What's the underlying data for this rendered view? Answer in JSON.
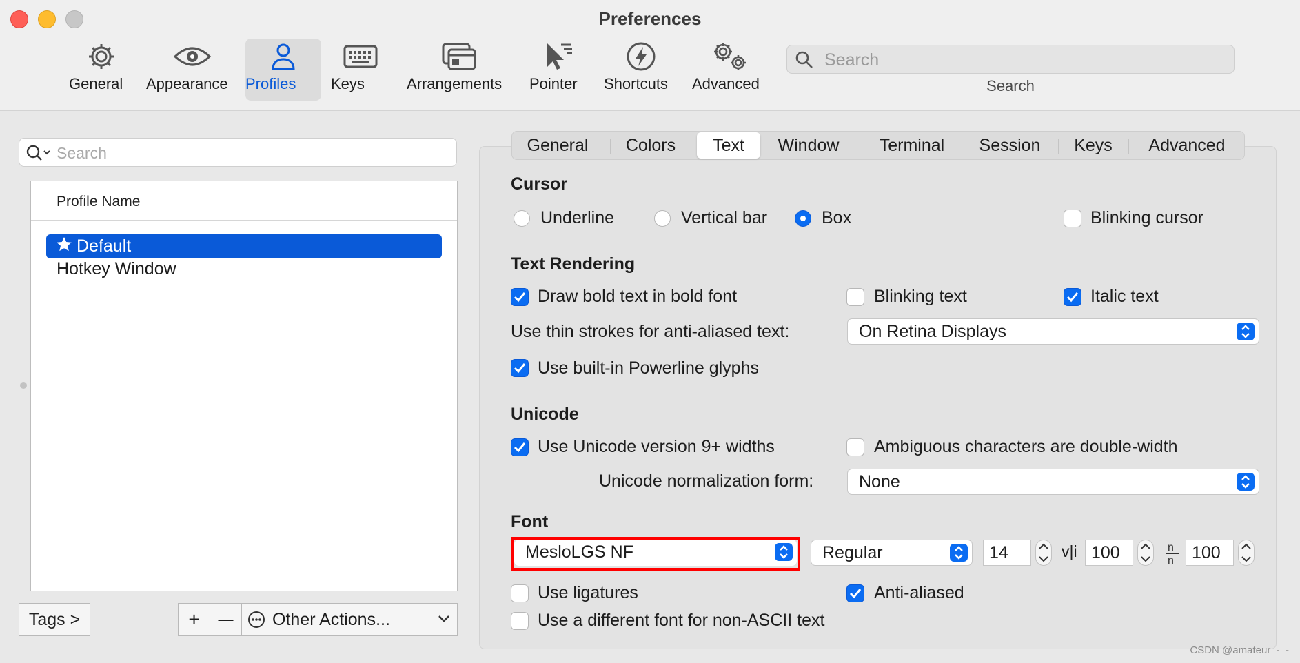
{
  "window": {
    "title": "Preferences"
  },
  "toolbar": {
    "items": [
      {
        "label": "General",
        "icon": "gear-icon"
      },
      {
        "label": "Appearance",
        "icon": "eye-icon"
      },
      {
        "label": "Profiles",
        "icon": "person-icon",
        "active": true
      },
      {
        "label": "Keys",
        "icon": "keyboard-icon"
      },
      {
        "label": "Arrangements",
        "icon": "windows-icon"
      },
      {
        "label": "Pointer",
        "icon": "pointer-icon"
      },
      {
        "label": "Shortcuts",
        "icon": "lightning-icon"
      },
      {
        "label": "Advanced",
        "icon": "gears-icon"
      }
    ],
    "search": {
      "placeholder": "Search",
      "caption": "Search"
    }
  },
  "profiles": {
    "search_placeholder": "Search",
    "column_header": "Profile Name",
    "items": [
      {
        "name": "Default",
        "selected": true,
        "starred": true
      },
      {
        "name": "Hotkey Window",
        "selected": false
      }
    ],
    "tags_button": "Tags >",
    "add_button": "+",
    "remove_button": "—",
    "other_actions": "Other Actions..."
  },
  "tabs": [
    {
      "label": "General"
    },
    {
      "label": "Colors"
    },
    {
      "label": "Text",
      "active": true
    },
    {
      "label": "Window"
    },
    {
      "label": "Terminal"
    },
    {
      "label": "Session"
    },
    {
      "label": "Keys"
    },
    {
      "label": "Advanced"
    }
  ],
  "cursor": {
    "title": "Cursor",
    "underline": "Underline",
    "vertical_bar": "Vertical bar",
    "box": "Box",
    "selected": "Box",
    "blinking_cursor": "Blinking cursor",
    "blinking_cursor_checked": false
  },
  "text_rendering": {
    "title": "Text Rendering",
    "bold_label": "Draw bold text in bold font",
    "bold_checked": true,
    "blinking_label": "Blinking text",
    "blinking_checked": false,
    "italic_label": "Italic text",
    "italic_checked": true,
    "thin_strokes_label": "Use thin strokes for anti-aliased text:",
    "thin_strokes_value": "On Retina Displays",
    "powerline_label": "Use built-in Powerline glyphs",
    "powerline_checked": true
  },
  "unicode": {
    "title": "Unicode",
    "widths_label": "Use Unicode version 9+ widths",
    "widths_checked": true,
    "ambiguous_label": "Ambiguous characters are double-width",
    "ambiguous_checked": false,
    "normalization_label": "Unicode normalization form:",
    "normalization_value": "None"
  },
  "font": {
    "title": "Font",
    "family": "MesloLGS NF",
    "style": "Regular",
    "size": "14",
    "vertical_spacing": "100",
    "horizontal_spacing": "100",
    "ligatures_label": "Use ligatures",
    "ligatures_checked": false,
    "anti_aliased_label": "Anti-aliased",
    "anti_aliased_checked": true,
    "non_ascii_label": "Use a different font for non-ASCII text",
    "non_ascii_checked": false
  },
  "colors": {
    "accent": "#0a6cf2",
    "selection": "#0a5ad8",
    "highlight_box": "#ff0000"
  },
  "watermark": "CSDN @amateur_-_-"
}
